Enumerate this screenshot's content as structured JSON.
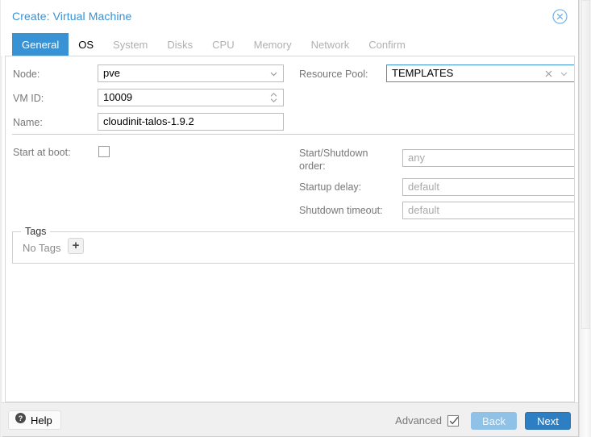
{
  "window": {
    "title": "Create: Virtual Machine",
    "close_icon": "close-circle-icon"
  },
  "tabs": [
    {
      "label": "General",
      "state": "active"
    },
    {
      "label": "OS",
      "state": "enabled"
    },
    {
      "label": "System",
      "state": "disabled"
    },
    {
      "label": "Disks",
      "state": "disabled"
    },
    {
      "label": "CPU",
      "state": "disabled"
    },
    {
      "label": "Memory",
      "state": "disabled"
    },
    {
      "label": "Network",
      "state": "disabled"
    },
    {
      "label": "Confirm",
      "state": "disabled"
    }
  ],
  "form": {
    "node": {
      "label": "Node:",
      "value": "pve",
      "trigger_icon": "chevron-down-icon"
    },
    "vmid": {
      "label": "VM ID:",
      "value": "10009",
      "trigger_icon": "spinner-updown-icon"
    },
    "name": {
      "label": "Name:",
      "value": "cloudinit-talos-1.9.2"
    },
    "resource_pool": {
      "label": "Resource Pool:",
      "value": "TEMPLATES",
      "clear_icon": "clear-x-icon",
      "trigger_icon": "chevron-down-icon",
      "focused": true
    },
    "start_at_boot": {
      "label": "Start at boot:",
      "checked": false
    },
    "startup_order": {
      "label": "Start/Shutdown order:",
      "value": "",
      "placeholder": "any"
    },
    "startup_delay": {
      "label": "Startup delay:",
      "value": "",
      "placeholder": "default"
    },
    "shutdown_timeout": {
      "label": "Shutdown timeout:",
      "value": "",
      "placeholder": "default"
    },
    "tags": {
      "legend": "Tags",
      "empty_text": "No Tags",
      "add_label": "+",
      "add_icon": "plus-icon"
    }
  },
  "footer": {
    "help_label": "Help",
    "help_icon": "question-circle-icon",
    "advanced_label": "Advanced",
    "advanced_checked": true,
    "back_label": "Back",
    "next_label": "Next"
  },
  "colors": {
    "accent": "#3892d4",
    "primary_button": "#2e7ec4",
    "disabled_button": "#8fc2e6",
    "label_text": "#777777",
    "placeholder_text": "#a8a8a8"
  }
}
